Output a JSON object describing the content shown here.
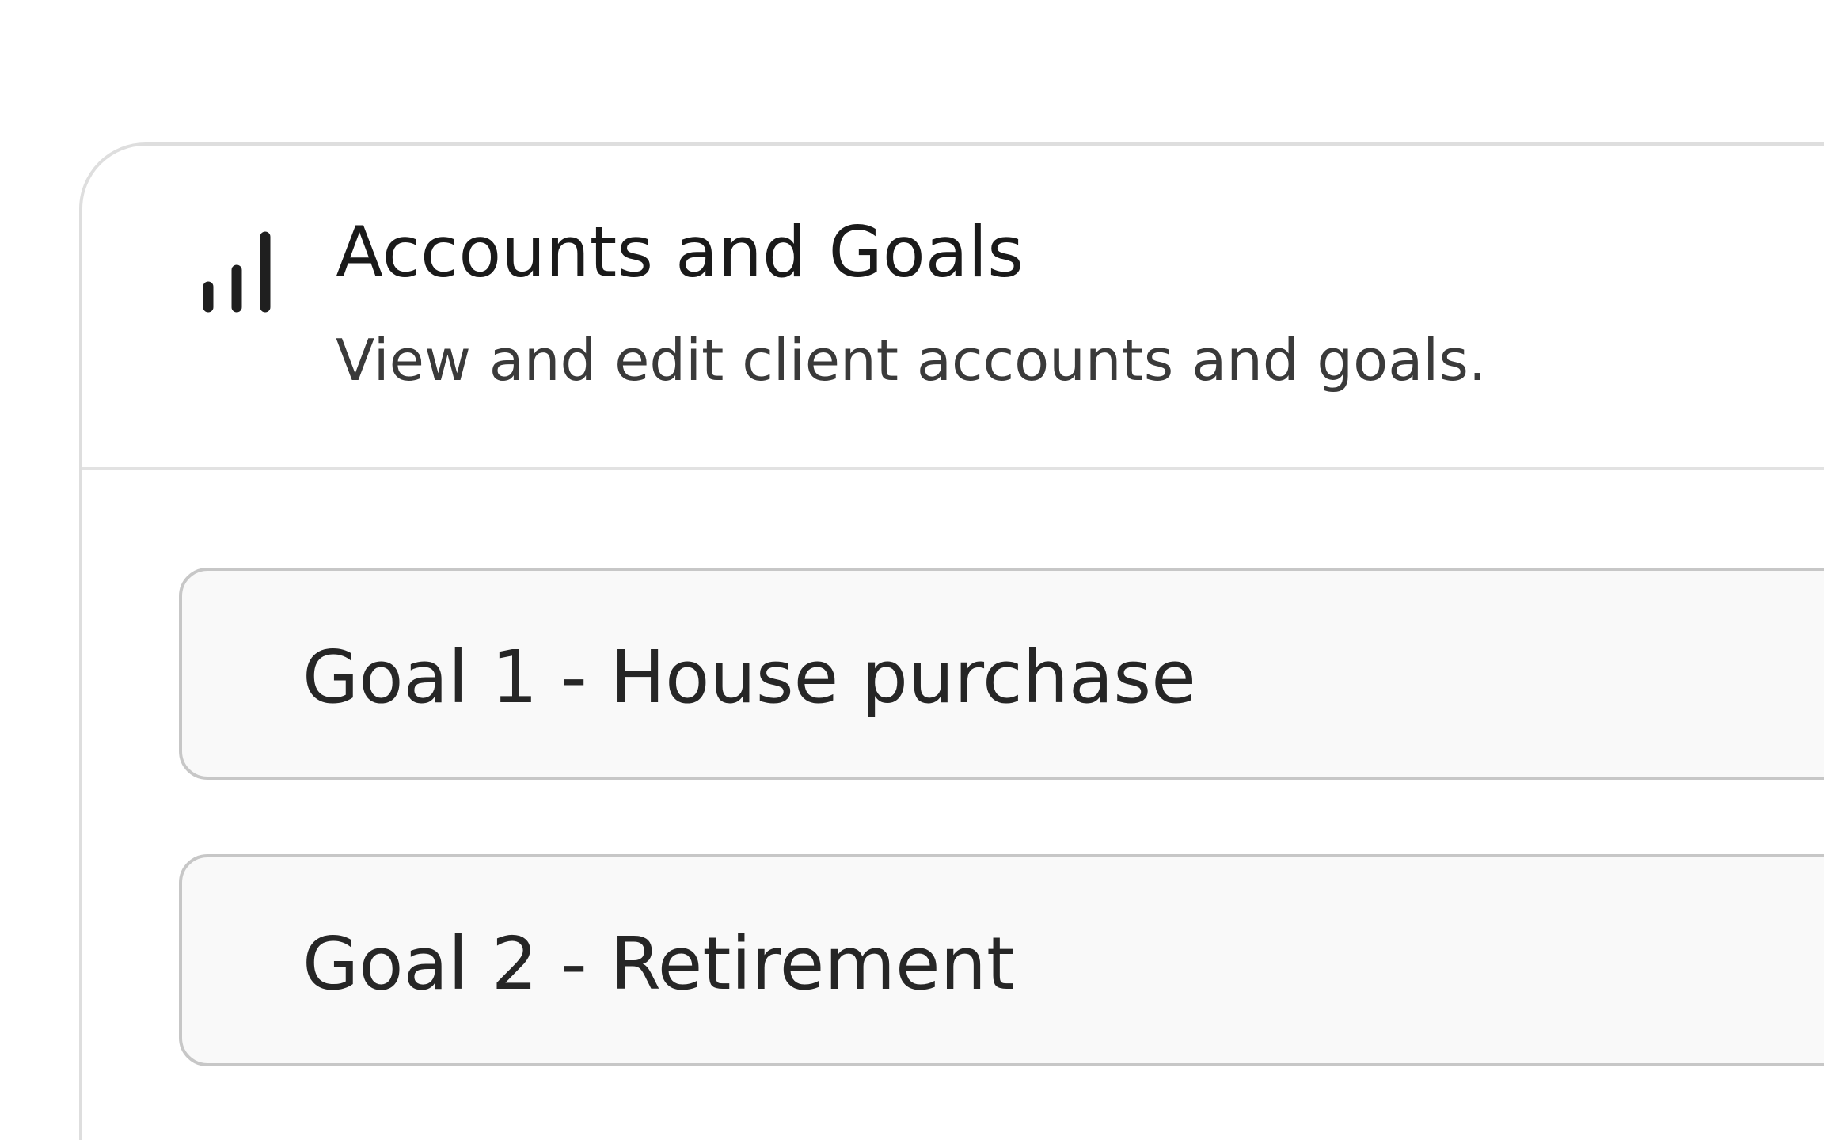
{
  "section": {
    "icon": "bar-chart-icon",
    "title": "Accounts and Goals",
    "subtitle": "View and edit client accounts and goals."
  },
  "goals": [
    {
      "label": "Goal 1 - House purchase"
    },
    {
      "label": "Goal 2 - Retirement"
    }
  ],
  "colors": {
    "card_border": "#dedede",
    "goal_border": "#c7c7c7",
    "goal_background": "#f9f9f9",
    "text": "#1f1f1f"
  }
}
